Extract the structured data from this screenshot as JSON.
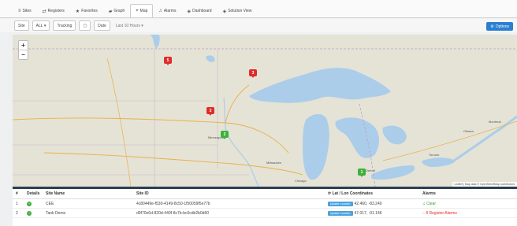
{
  "nav": {
    "tabs": [
      {
        "icon": "≡",
        "label": "Sites"
      },
      {
        "icon": "⇄",
        "label": "Registers"
      },
      {
        "icon": "★",
        "label": "Favorites"
      },
      {
        "icon": "▰",
        "label": "Graph"
      },
      {
        "icon": "⌖",
        "label": "Map"
      },
      {
        "icon": "♫",
        "label": "Alarms"
      },
      {
        "icon": "◈",
        "label": "Dashboard"
      },
      {
        "icon": "◈",
        "label": "Solution View"
      }
    ],
    "active_index": 4
  },
  "filters": {
    "site_label": "Site",
    "site_value": "ALL",
    "tracking_label": "Tracking",
    "date_label": "Date",
    "range_text": "Last 10 Hours"
  },
  "options_button": "Options",
  "map": {
    "zoom_in": "+",
    "zoom_out": "−",
    "markers": [
      {
        "label": "5",
        "status": "alarm"
      },
      {
        "label": "3",
        "status": "alarm"
      },
      {
        "label": "3",
        "status": "alarm"
      },
      {
        "label": "2",
        "status": "ok"
      },
      {
        "label": "1",
        "status": "ok"
      }
    ],
    "place_labels": [
      "Minneapolis",
      "Milwaukee",
      "Chicago",
      "Detroit",
      "Toronto",
      "Ottawa",
      "Montreal"
    ],
    "attribution": "Leaflet | Map data © OpenStreetMap contributors"
  },
  "table": {
    "headers": {
      "num": "# ",
      "details": "Details",
      "site_name": "Site Name",
      "site_id": "Site ID",
      "latlon": "Lat / Lon Coordinates",
      "alarms": "Alarms"
    },
    "rows": [
      {
        "num": "1",
        "site_name": "CEE",
        "site_id": "4c80449e-f530-4149-8c50-1f50059f5e77b",
        "loc_btn": "Update Location",
        "coords": "42.460, -83.240",
        "alarm": "Clear"
      },
      {
        "num": "2",
        "site_name": "Tank Demo",
        "site_id": "d0f70e6d-820d-440f-8c7b-bc0cdb2b0d60",
        "loc_btn": "Update Location",
        "coords": "47.017, -91.146",
        "alarm": "8 Register Alarms"
      }
    ]
  },
  "colors": {
    "accent": "#2b7fd1",
    "alarm": "#e02b2b",
    "ok": "#3cb03c",
    "water": "#abcdea",
    "land": "#e5e3d6",
    "table_divider": "#2d3e4f"
  }
}
